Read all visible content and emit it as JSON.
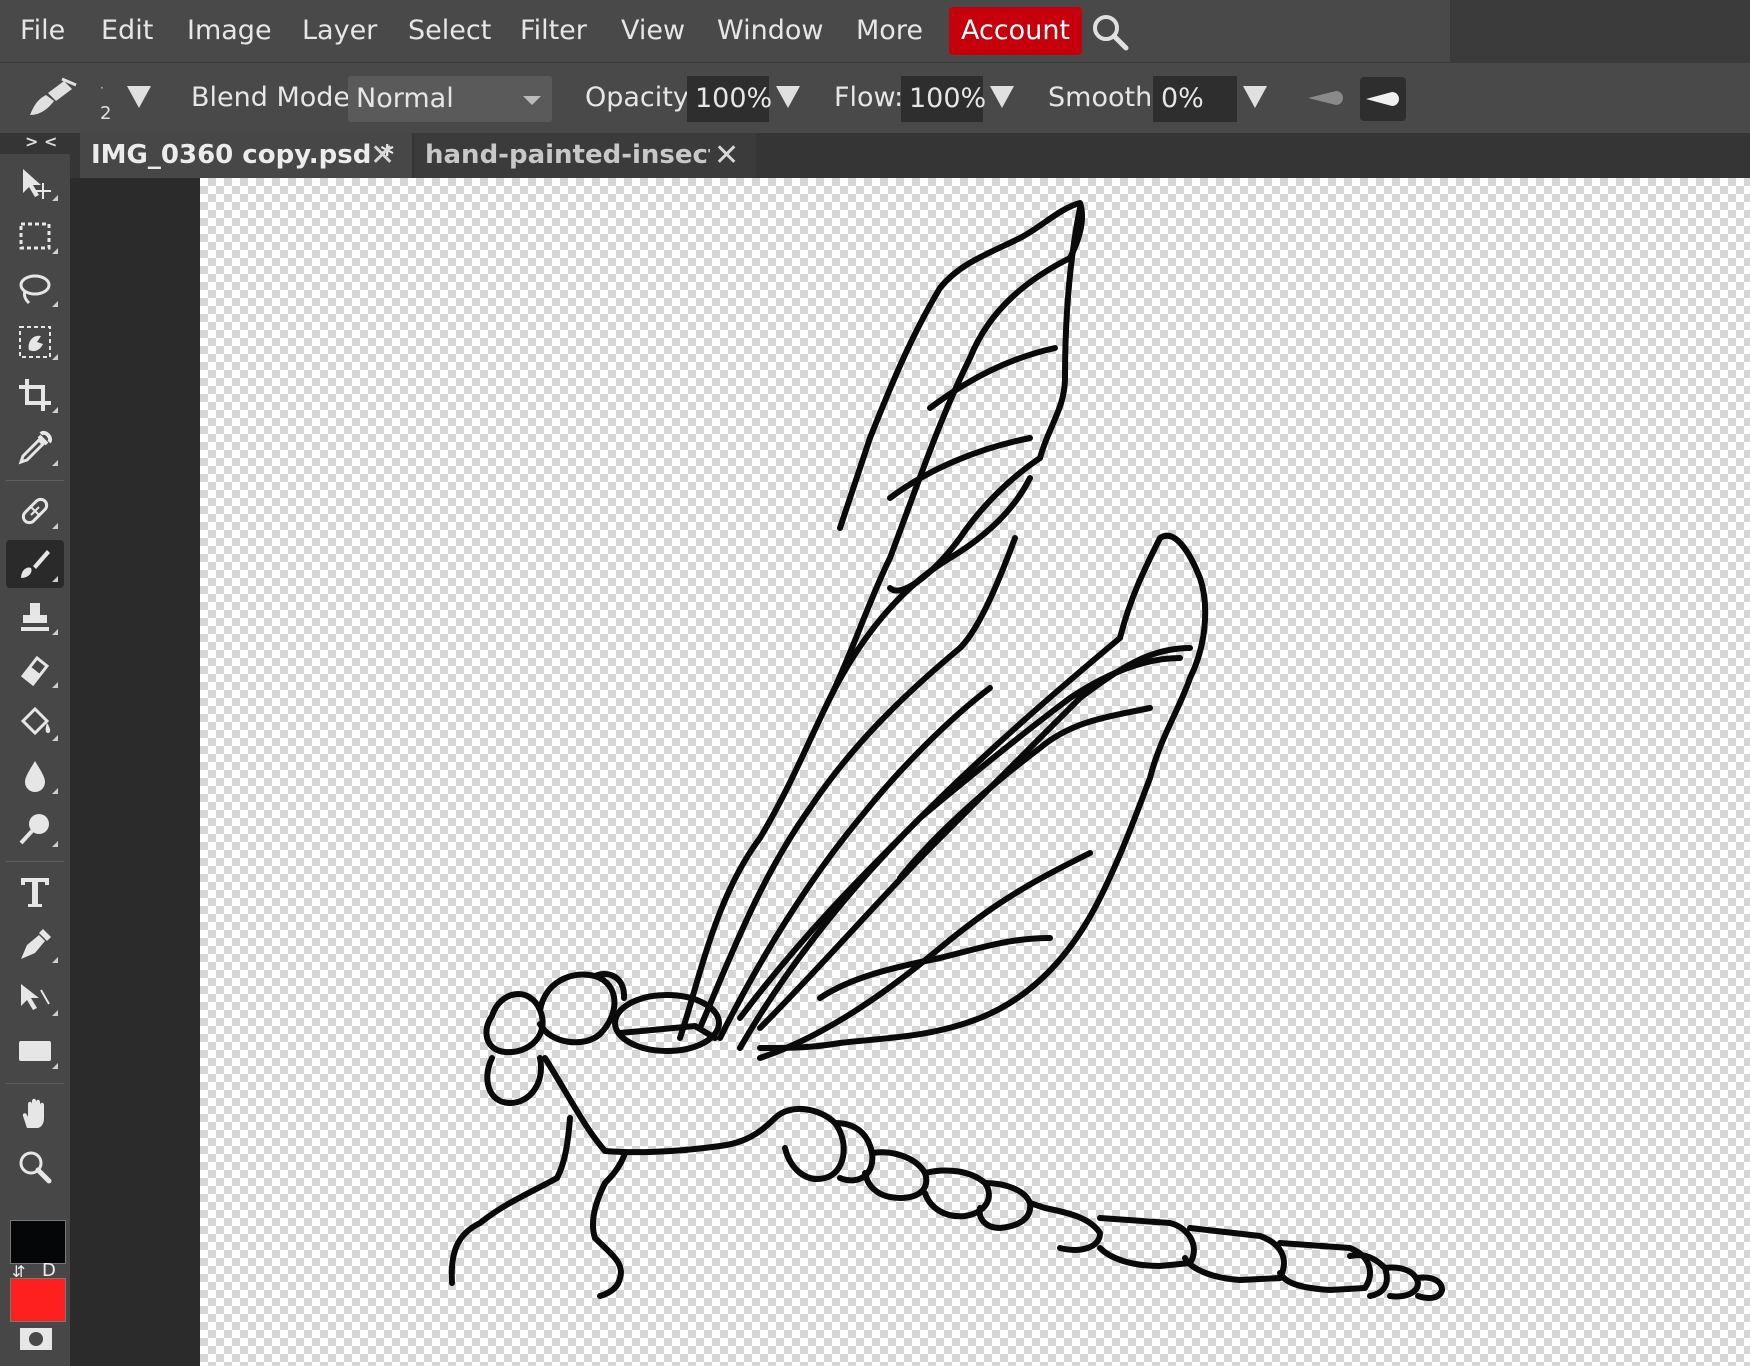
{
  "menu": {
    "items": [
      "File",
      "Edit",
      "Image",
      "Layer",
      "Select",
      "Filter",
      "View",
      "Window",
      "More"
    ],
    "account": "Account"
  },
  "options": {
    "brush_size": "2",
    "blend_label": "Blend Mode:",
    "blend_value": "Normal",
    "opacity_label": "Opacity:",
    "opacity_value": "100%",
    "flow_label": "Flow:",
    "flow_value": "100%",
    "smooth_label": "Smooth:",
    "smooth_value": "0%"
  },
  "tabs": [
    {
      "label": "IMG_0360 copy.psd *",
      "active": true
    },
    {
      "label": "hand-painted-insects",
      "active": false
    }
  ],
  "toolbar": {
    "collapse": "> <",
    "default_colors": "D",
    "foreground_color": "#050608",
    "background_color": "#fe1f1f",
    "tools": [
      "move-tool",
      "marquee-tool",
      "lasso-tool",
      "quick-select-tool",
      "crop-tool",
      "eyedropper-tool",
      "healing-tool",
      "brush-tool",
      "clone-stamp-tool",
      "eraser-tool",
      "paint-bucket-tool",
      "blur-tool",
      "dodge-tool",
      "type-tool",
      "pen-tool",
      "path-select-tool",
      "shape-tool",
      "hand-tool",
      "zoom-tool"
    ],
    "active_tool": "brush-tool"
  },
  "colors": {
    "account_red": "#c5000c",
    "panel": "#494949"
  }
}
